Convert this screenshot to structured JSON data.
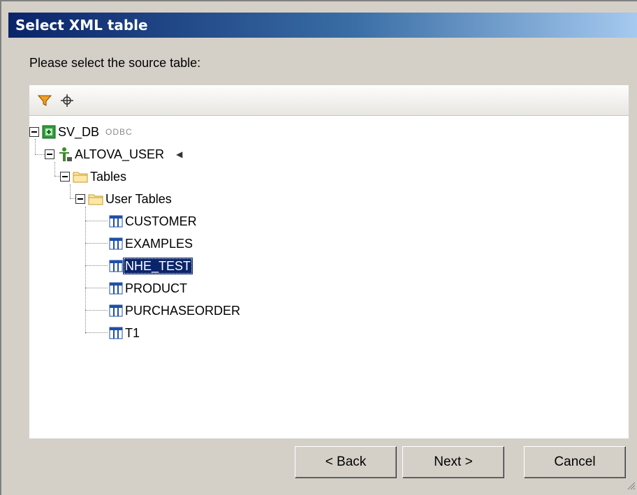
{
  "window": {
    "title": "Select XML table"
  },
  "prompt": "Please select the source table:",
  "toolbar": {
    "filter_icon": "filter-icon",
    "locate_icon": "locate-icon"
  },
  "tree": {
    "datasource": {
      "name": "SV_DB",
      "type": "ODBC",
      "icon": "database-icon"
    },
    "user": {
      "name": "ALTOVA_USER",
      "icon": "user-icon"
    },
    "tables_folder": {
      "label": "Tables",
      "icon": "folder-icon"
    },
    "user_tables_folder": {
      "label": "User Tables",
      "icon": "folder-icon"
    },
    "tables": [
      {
        "label": "CUSTOMER"
      },
      {
        "label": "EXAMPLES"
      },
      {
        "label": "NHE_TEST",
        "selected": true
      },
      {
        "label": "PRODUCT"
      },
      {
        "label": "PURCHASEORDER"
      },
      {
        "label": "T1"
      }
    ]
  },
  "buttons": {
    "back": "< Back",
    "next": "Next >",
    "cancel": "Cancel"
  },
  "colors": {
    "selection": "#0a246a",
    "title_start": "#0a246a",
    "title_end": "#a6caf0"
  }
}
